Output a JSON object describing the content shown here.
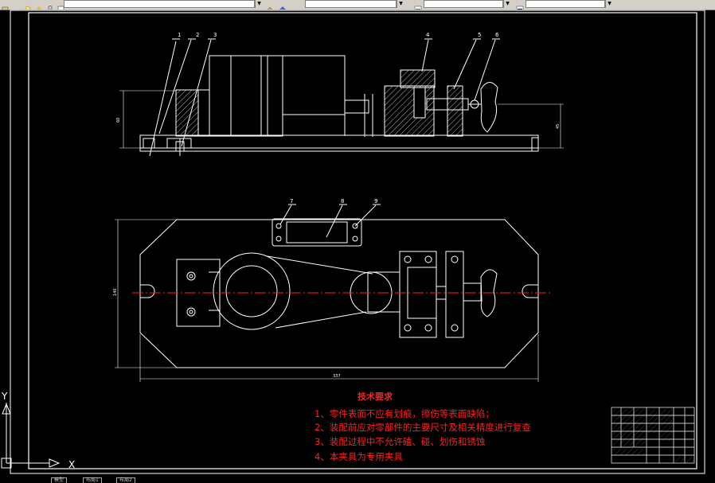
{
  "toolbar": {
    "layer_combo": "",
    "color_combo": "",
    "linetype_combo": "",
    "lineweight_combo": ""
  },
  "drawing": {
    "part_labels": [
      "1",
      "2",
      "3",
      "4",
      "5",
      "6",
      "7",
      "8",
      "9"
    ],
    "dim_left_height": "60",
    "dim_right_height": "45",
    "dim_bottom_width": "337",
    "dim_left_width": "140"
  },
  "tech_requirements": {
    "title": "技术要求",
    "lines": [
      "1、零件表面不应有划痕，擦伤等表面缺陷；",
      "2、装配前应对零部件的主要尺寸及相关精度进行复查",
      "3、装配过程中不允许磕、碰、划伤和锈蚀",
      "4、本夹具为专用夹具"
    ]
  },
  "ucs": {
    "x_label": "X",
    "y_label": "Y"
  },
  "tabs": [
    "模型",
    "布局1",
    "布局2"
  ],
  "colors": {
    "background": "#000000",
    "lines": "#ffffff",
    "centerline": "#ff0000",
    "annotation": "#ff2020"
  }
}
